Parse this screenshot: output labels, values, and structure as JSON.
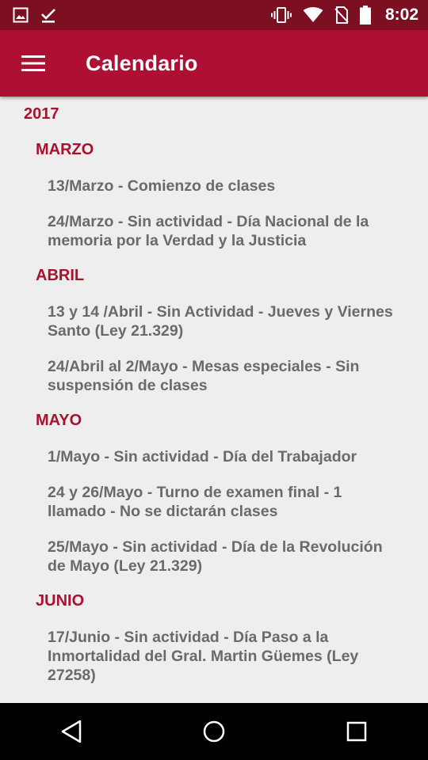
{
  "status_bar": {
    "time": "8:02",
    "icons": [
      "image-icon",
      "download-done-icon",
      "vibrate-icon",
      "wifi-icon",
      "no-sim-icon",
      "battery-icon"
    ]
  },
  "app_bar": {
    "title": "Calendario",
    "color": "#ad1032"
  },
  "calendar": {
    "year": "2017",
    "months": [
      {
        "name": "MARZO",
        "events": [
          "13/Marzo - Comienzo de clases",
          "24/Marzo - Sin actividad - Día Nacional de la memoria por la Verdad y la Justicia"
        ]
      },
      {
        "name": "ABRIL",
        "events": [
          "13 y 14 /Abril - Sin Actividad - Jueves y Viernes Santo (Ley 21.329)",
          "24/Abril al 2/Mayo - Mesas especiales - Sin suspensión de clases"
        ]
      },
      {
        "name": "MAYO",
        "events": [
          "1/Mayo - Sin actividad - Día del Trabajador",
          "24 y 26/Mayo - Turno de examen final - 1 llamado - No se dictarán clases",
          "25/Mayo - Sin actividad - Día de la Revolución de Mayo (Ley 21.329)"
        ]
      },
      {
        "name": "JUNIO",
        "events": [
          "17/Junio - Sin actividad - Día Paso a la Inmortalidad del Gral. Martin Güemes (Ley 27258)"
        ]
      }
    ]
  },
  "nav_bar": {
    "buttons": [
      "back-icon",
      "home-icon",
      "recents-icon"
    ]
  }
}
